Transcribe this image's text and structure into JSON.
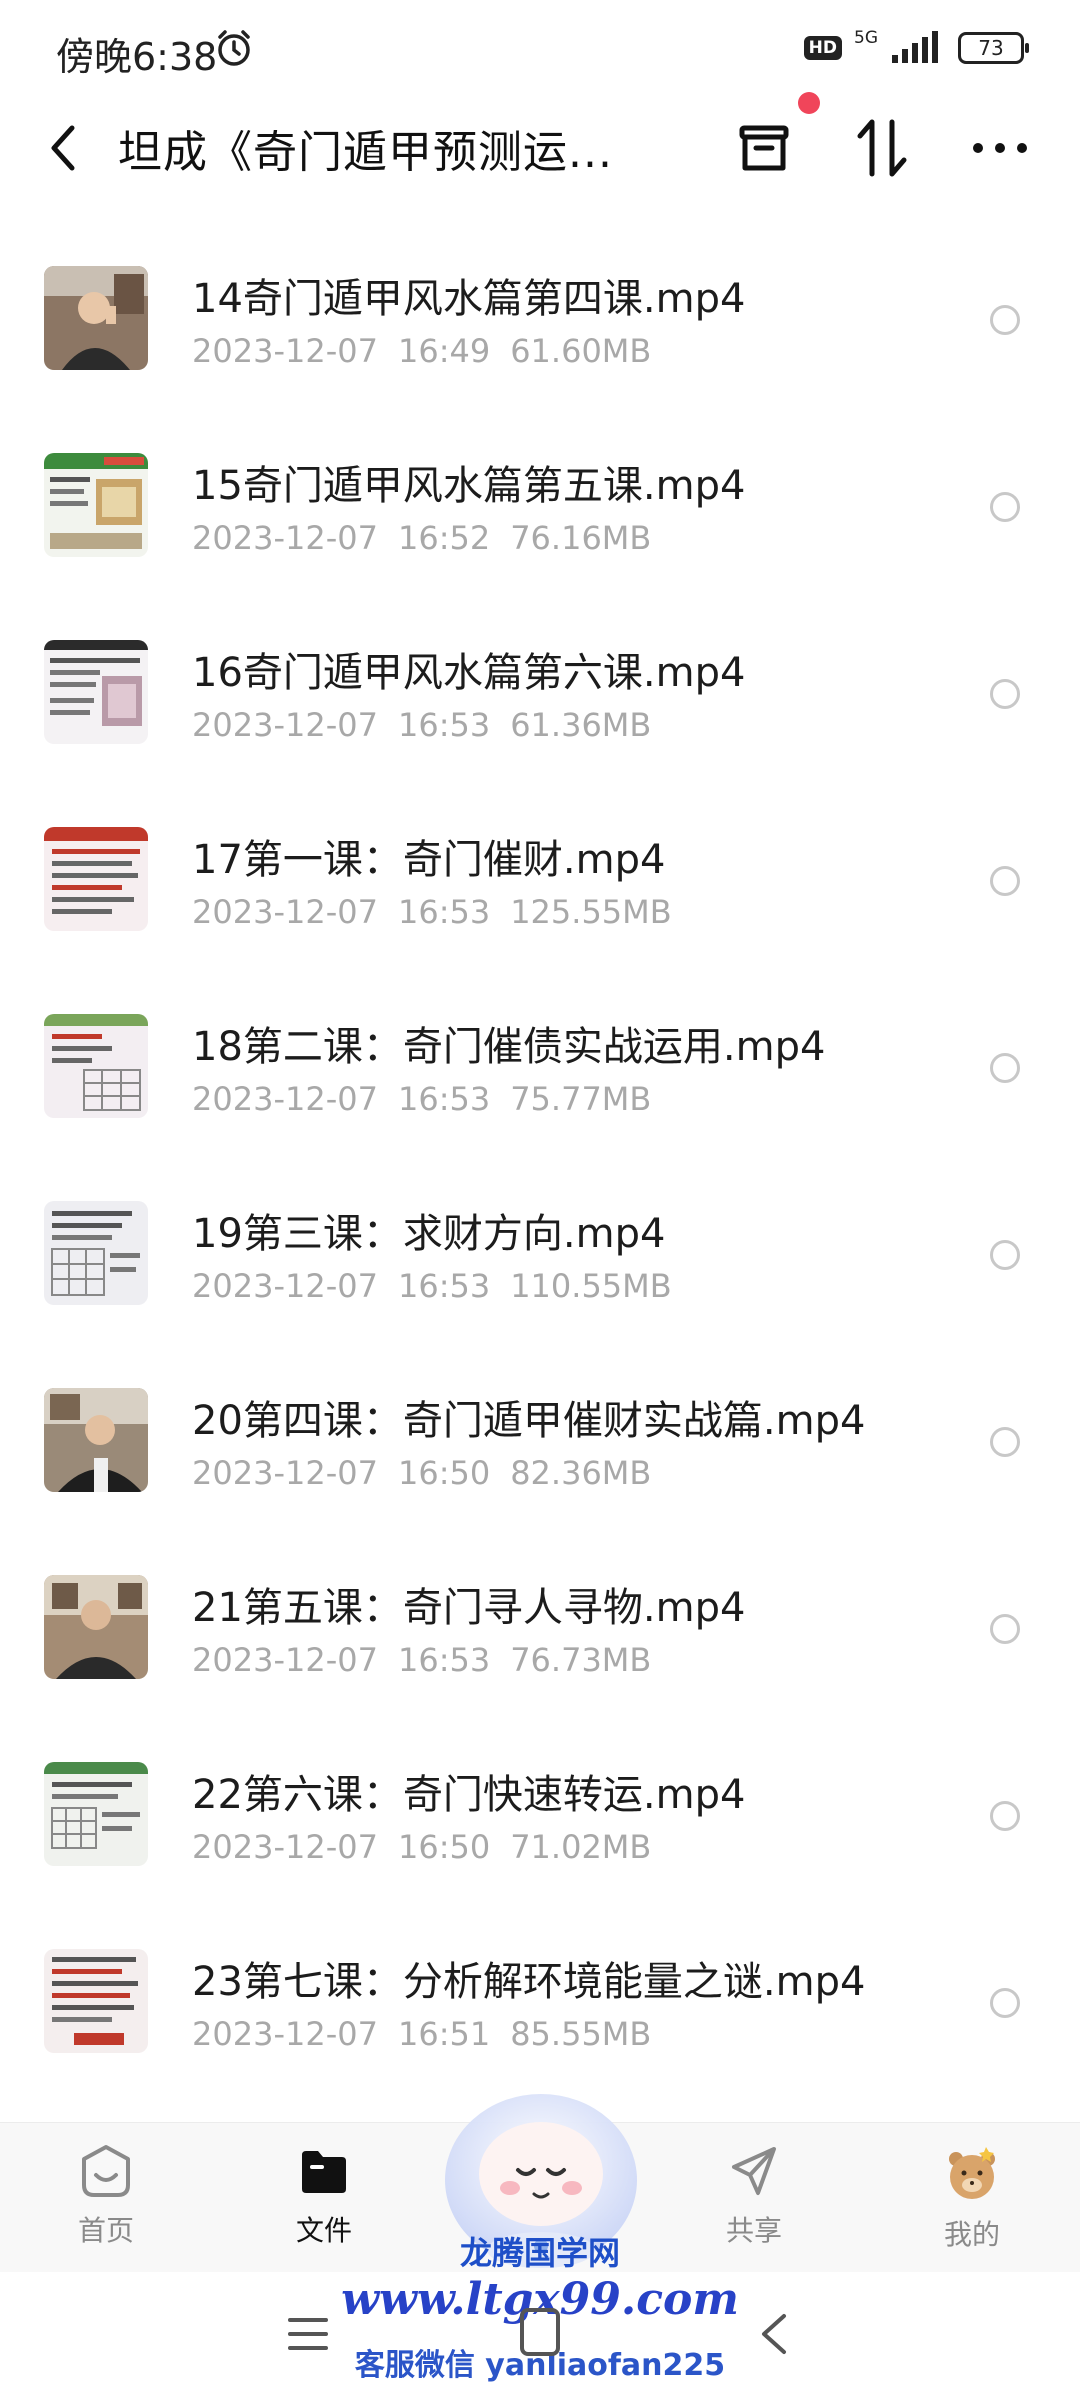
{
  "status_bar": {
    "time": "傍晚6:38",
    "hd": "HD",
    "network": "5G",
    "battery": "73"
  },
  "header": {
    "title": "坦成《奇门遁甲预测运..."
  },
  "files": [
    {
      "name": "14奇门遁甲风水篇第四课.mp4",
      "date": "2023-12-07",
      "time": "16:49",
      "size": "61.60MB"
    },
    {
      "name": "15奇门遁甲风水篇第五课.mp4",
      "date": "2023-12-07",
      "time": "16:52",
      "size": "76.16MB"
    },
    {
      "name": "16奇门遁甲风水篇第六课.mp4",
      "date": "2023-12-07",
      "time": "16:53",
      "size": "61.36MB"
    },
    {
      "name": "17第一课：奇门催财.mp4",
      "date": "2023-12-07",
      "time": "16:53",
      "size": "125.55MB"
    },
    {
      "name": "18第二课：奇门催债实战运用.mp4",
      "date": "2023-12-07",
      "time": "16:53",
      "size": "75.77MB"
    },
    {
      "name": "19第三课：求财方向.mp4",
      "date": "2023-12-07",
      "time": "16:53",
      "size": "110.55MB"
    },
    {
      "name": "20第四课：奇门遁甲催财实战篇.mp4",
      "date": "2023-12-07",
      "time": "16:50",
      "size": "82.36MB"
    },
    {
      "name": "21第五课：奇门寻人寻物.mp4",
      "date": "2023-12-07",
      "time": "16:53",
      "size": "76.73MB"
    },
    {
      "name": "22第六课：奇门快速转运.mp4",
      "date": "2023-12-07",
      "time": "16:50",
      "size": "71.02MB"
    },
    {
      "name": "23第七课：分析解环境能量之谜.mp4",
      "date": "2023-12-07",
      "time": "16:51",
      "size": "85.55MB"
    }
  ],
  "nav": {
    "home": "首页",
    "files": "文件",
    "share": "共享",
    "me": "我的"
  },
  "watermark": {
    "line1": "龙腾国学网",
    "line2": "www.ltgx99.com",
    "line3": "客服微信 yanliaofan225"
  },
  "colors": {
    "accent_dot": "#f0455a",
    "meta_text": "#a8a8a8",
    "watermark_blue": "#2742c7"
  }
}
